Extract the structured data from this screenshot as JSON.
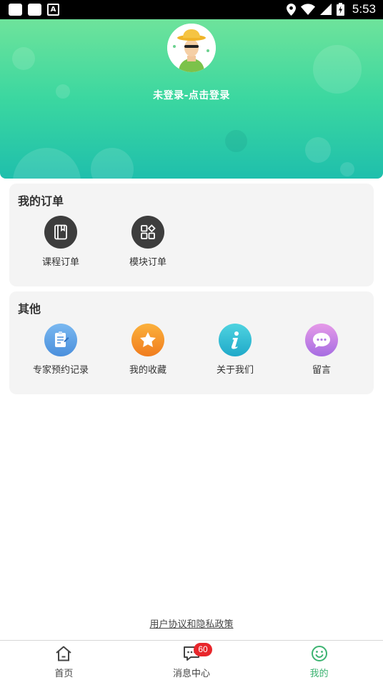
{
  "status_bar": {
    "time": "5:53"
  },
  "header": {
    "login_text": "未登录-点击登录"
  },
  "orders": {
    "title": "我的订单",
    "items": [
      {
        "label": "课程订单",
        "icon": "book-icon"
      },
      {
        "label": "模块订单",
        "icon": "grid-icon"
      }
    ]
  },
  "other": {
    "title": "其他",
    "items": [
      {
        "label": "专家预约记录",
        "icon": "notepad-icon"
      },
      {
        "label": "我的收藏",
        "icon": "star-icon"
      },
      {
        "label": "关于我们",
        "icon": "info-icon"
      },
      {
        "label": "留言",
        "icon": "chat-bubble-icon"
      }
    ]
  },
  "policy_link": "用户协议和隐私政策",
  "bottom_nav": {
    "items": [
      {
        "label": "首页",
        "icon": "home-icon"
      },
      {
        "label": "消息中心",
        "icon": "message-icon",
        "badge": "60"
      },
      {
        "label": "我的",
        "icon": "smile-icon",
        "active": true
      }
    ]
  },
  "colors": {
    "accent": "#3cb371",
    "badge": "#e8262b",
    "header_top": "#6ee39b",
    "header_bottom": "#1fbfac"
  }
}
